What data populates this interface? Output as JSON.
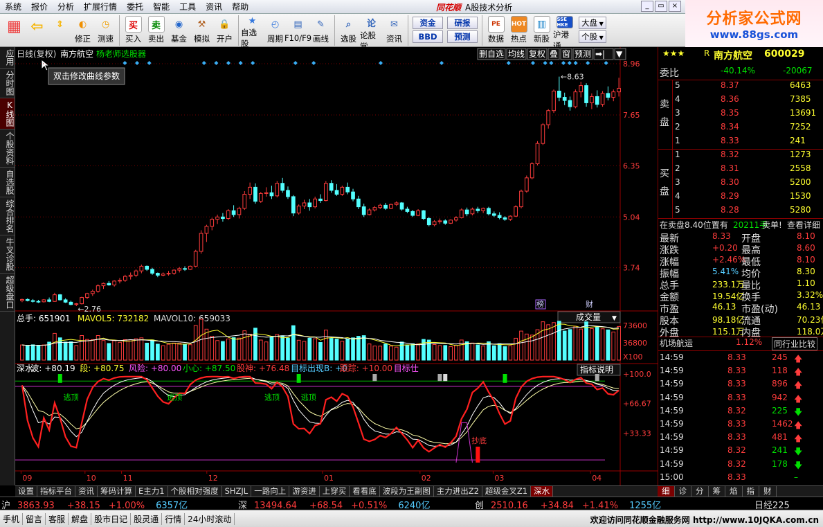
{
  "menu": [
    "系统",
    "报价",
    "分析",
    "扩展行情",
    "委托",
    "智能",
    "工具",
    "资讯",
    "帮助"
  ],
  "app_title": {
    "brand": "同花顺",
    "module": "A股技术分析"
  },
  "window_buttons": [
    "_",
    "▭",
    "×"
  ],
  "toolbar": {
    "buttons": [
      {
        "label": "",
        "icon": "multi-window-icon"
      },
      {
        "label": "",
        "icon": "back-arrow-icon"
      },
      {
        "label": "",
        "icon": "up-down-arrow-icon"
      },
      {
        "label": "修正",
        "icon": "correction-icon"
      },
      {
        "label": "测速",
        "icon": "speed-test-icon"
      },
      {
        "label": "买入",
        "icon": "buy-icon",
        "glyph": "买"
      },
      {
        "label": "卖出",
        "icon": "sell-icon",
        "glyph": "卖"
      },
      {
        "label": "基金",
        "icon": "fund-icon"
      },
      {
        "label": "模拟",
        "icon": "simulate-icon"
      },
      {
        "label": "开户",
        "icon": "lock-icon"
      },
      {
        "label": "自选股",
        "icon": "star-icon"
      },
      {
        "label": "周期",
        "icon": "clock-icon"
      },
      {
        "label": "F10/F9",
        "icon": "f10-icon"
      },
      {
        "label": "画线",
        "icon": "pen-icon"
      },
      {
        "label": "选股",
        "icon": "select-stock-icon"
      },
      {
        "label": "论股堂",
        "icon": "forum-icon"
      },
      {
        "label": "资讯",
        "icon": "news-icon"
      }
    ],
    "pill_buttons": [
      "资金",
      "BBD",
      "研报",
      "预测"
    ],
    "right_buttons": [
      {
        "label": "数据",
        "icon": "pe-icon",
        "glyph": "PE"
      },
      {
        "label": "热点",
        "icon": "hot-icon",
        "glyph": "HOT"
      },
      {
        "label": "新股",
        "icon": "new-stock-icon"
      },
      {
        "label": "沪港通",
        "icon": "hk-connect-icon",
        "glyph": "SSE HKE"
      }
    ],
    "dropdowns": [
      "大盘",
      "个股"
    ]
  },
  "logo": {
    "title": "分析家公式网",
    "url": "www.88gs.com"
  },
  "left_tabs": [
    {
      "label": "应用",
      "active": false
    },
    {
      "label": "分时图",
      "active": false
    },
    {
      "label": "K线图",
      "active": true
    },
    {
      "label": "个股资料",
      "active": false
    },
    {
      "label": "自选股",
      "active": false
    },
    {
      "label": "综合排名",
      "active": false
    },
    {
      "label": "牛叉诊股",
      "active": false
    },
    {
      "label": "超级盘口",
      "active": false
    }
  ],
  "kchart": {
    "period_label": "日线(复权)",
    "stock_name": "南方航空",
    "formula_name": "杨老师选股器",
    "tooltip": "双击修改曲线参数",
    "buttons": [
      "删自选",
      "均线",
      "复权",
      "叠",
      "窗",
      "预测",
      "➡|",
      "▼"
    ],
    "high_label": "8.63",
    "low_label": "2.76",
    "event_labels": [
      "榜",
      "财"
    ],
    "price_ticks": [
      "8.96",
      "7.65",
      "6.35",
      "5.04",
      "3.74"
    ]
  },
  "chart_data": {
    "type": "candlestick",
    "x_ticks": [
      "09",
      "10",
      "11",
      "12",
      "01",
      "02",
      "03",
      "04"
    ],
    "price_axis": {
      "min": 2.76,
      "max": 8.96,
      "ticks": [
        8.96,
        7.65,
        6.35,
        5.04,
        3.74
      ]
    },
    "ohlc": [
      [
        2.9,
        2.95,
        2.86,
        2.93
      ],
      [
        2.93,
        2.96,
        2.88,
        2.9
      ],
      [
        2.9,
        2.94,
        2.85,
        2.88
      ],
      [
        2.88,
        2.92,
        2.84,
        2.87
      ],
      [
        2.87,
        2.94,
        2.85,
        2.92
      ],
      [
        2.92,
        2.98,
        2.86,
        2.88
      ],
      [
        2.88,
        3.1,
        2.87,
        3.05
      ],
      [
        3.05,
        3.07,
        2.9,
        2.92
      ],
      [
        2.92,
        2.96,
        2.84,
        2.86
      ],
      [
        2.86,
        2.9,
        2.78,
        2.8
      ],
      [
        2.8,
        2.84,
        2.76,
        2.82
      ],
      [
        2.82,
        3.0,
        2.8,
        2.98
      ],
      [
        2.98,
        3.1,
        2.94,
        3.08
      ],
      [
        3.08,
        3.18,
        3.02,
        3.14
      ],
      [
        3.14,
        3.32,
        3.1,
        3.28
      ],
      [
        3.28,
        3.36,
        3.2,
        3.34
      ],
      [
        3.34,
        3.4,
        3.28,
        3.3
      ],
      [
        3.3,
        3.42,
        3.26,
        3.4
      ],
      [
        3.4,
        3.48,
        3.34,
        3.42
      ],
      [
        3.42,
        3.56,
        3.38,
        3.52
      ],
      [
        3.52,
        3.62,
        3.44,
        3.55
      ],
      [
        3.55,
        3.7,
        3.5,
        3.66
      ],
      [
        3.66,
        3.82,
        3.6,
        3.78
      ],
      [
        3.78,
        3.8,
        3.66,
        3.7
      ],
      [
        3.7,
        3.74,
        3.56,
        3.6
      ],
      [
        3.6,
        3.62,
        3.5,
        3.55
      ],
      [
        3.55,
        3.62,
        3.52,
        3.58
      ],
      [
        3.58,
        3.66,
        3.54,
        3.6
      ],
      [
        3.6,
        3.7,
        3.56,
        3.68
      ],
      [
        3.68,
        3.76,
        3.62,
        3.72
      ],
      [
        3.72,
        3.78,
        3.66,
        3.7
      ],
      [
        3.7,
        3.8,
        3.68,
        3.78
      ],
      [
        3.78,
        4.2,
        3.76,
        4.16
      ],
      [
        4.16,
        4.7,
        4.1,
        4.62
      ],
      [
        4.62,
        4.84,
        4.4,
        4.8
      ],
      [
        4.8,
        5.02,
        4.7,
        4.98
      ],
      [
        4.98,
        5.1,
        4.86,
        5.04
      ],
      [
        5.04,
        5.14,
        4.92,
        5.0
      ],
      [
        5.0,
        5.24,
        4.96,
        5.2
      ],
      [
        5.2,
        5.34,
        5.04,
        5.1
      ],
      [
        5.1,
        5.3,
        5.0,
        5.26
      ],
      [
        5.26,
        5.7,
        5.22,
        5.62
      ],
      [
        5.62,
        5.92,
        5.5,
        5.8
      ],
      [
        5.8,
        5.9,
        5.38,
        5.44
      ],
      [
        5.44,
        5.68,
        5.4,
        5.64
      ],
      [
        5.64,
        5.8,
        5.56,
        5.66
      ],
      [
        5.66,
        5.84,
        5.5,
        5.58
      ],
      [
        5.58,
        5.96,
        5.54,
        5.9
      ],
      [
        5.9,
        6.04,
        5.66,
        5.72
      ],
      [
        5.72,
        5.82,
        5.5,
        5.56
      ],
      [
        5.56,
        5.6,
        5.06,
        5.14
      ],
      [
        5.14,
        5.36,
        5.1,
        5.32
      ],
      [
        5.32,
        5.48,
        5.24,
        5.4
      ],
      [
        5.4,
        5.5,
        5.2,
        5.3
      ],
      [
        5.3,
        5.56,
        5.26,
        5.5
      ],
      [
        5.5,
        5.62,
        5.4,
        5.46
      ],
      [
        5.46,
        5.96,
        5.44,
        5.9
      ],
      [
        5.9,
        5.98,
        5.66,
        5.72
      ],
      [
        5.72,
        5.88,
        5.58,
        5.62
      ],
      [
        5.62,
        5.84,
        5.58,
        5.8
      ],
      [
        5.8,
        5.92,
        5.62,
        5.68
      ],
      [
        5.68,
        5.76,
        5.44,
        5.5
      ],
      [
        5.5,
        5.58,
        5.24,
        5.3
      ],
      [
        5.3,
        5.38,
        5.04,
        5.1
      ],
      [
        5.1,
        5.26,
        5.08,
        5.22
      ],
      [
        5.22,
        5.32,
        5.18,
        5.28
      ],
      [
        5.28,
        5.38,
        5.24,
        5.34
      ],
      [
        5.34,
        5.4,
        5.22,
        5.26
      ],
      [
        5.26,
        5.38,
        5.24,
        5.36
      ],
      [
        5.36,
        5.44,
        5.32,
        5.4
      ],
      [
        5.4,
        5.42,
        5.2,
        5.24
      ],
      [
        5.24,
        5.3,
        5.14,
        5.18
      ],
      [
        5.18,
        5.22,
        5.04,
        5.08
      ],
      [
        5.08,
        5.24,
        5.06,
        5.2
      ],
      [
        5.2,
        5.22,
        4.96,
        5.0
      ],
      [
        5.0,
        5.04,
        4.8,
        4.84
      ],
      [
        4.84,
        4.96,
        4.8,
        4.92
      ],
      [
        4.92,
        5.0,
        4.86,
        4.94
      ],
      [
        4.94,
        4.98,
        4.84,
        4.88
      ],
      [
        4.88,
        4.98,
        4.86,
        4.96
      ],
      [
        4.96,
        5.06,
        4.92,
        5.02
      ],
      [
        5.02,
        5.26,
        5.0,
        5.22
      ],
      [
        5.22,
        5.28,
        5.06,
        5.12
      ],
      [
        5.12,
        5.28,
        5.08,
        5.24
      ],
      [
        5.24,
        5.3,
        5.14,
        5.2
      ],
      [
        5.2,
        5.28,
        5.14,
        5.26
      ],
      [
        5.26,
        5.3,
        5.08,
        5.12
      ],
      [
        5.12,
        5.18,
        5.04,
        5.08
      ],
      [
        5.08,
        5.16,
        4.98,
        5.02
      ],
      [
        5.02,
        5.06,
        4.94,
        4.98
      ],
      [
        4.98,
        5.08,
        4.94,
        5.06
      ],
      [
        5.06,
        5.34,
        5.04,
        5.3
      ],
      [
        5.3,
        5.74,
        5.26,
        5.7
      ],
      [
        5.7,
        6.1,
        5.66,
        6.04
      ],
      [
        6.04,
        6.44,
        6.0,
        6.4
      ],
      [
        6.4,
        6.98,
        6.36,
        6.92
      ],
      [
        6.92,
        7.44,
        6.88,
        7.4
      ],
      [
        7.4,
        7.8,
        7.3,
        7.76
      ],
      [
        7.76,
        8.3,
        7.7,
        8.26
      ],
      [
        8.26,
        8.63,
        8.0,
        8.1
      ],
      [
        8.1,
        8.22,
        7.9,
        8.02
      ],
      [
        8.02,
        8.12,
        7.76,
        7.86
      ],
      [
        7.86,
        8.3,
        7.82,
        8.24
      ],
      [
        8.24,
        8.5,
        8.1,
        8.4
      ],
      [
        8.4,
        8.46,
        7.86,
        7.96
      ],
      [
        7.96,
        8.2,
        7.8,
        8.12
      ],
      [
        8.12,
        8.28,
        7.84,
        7.92
      ],
      [
        7.92,
        8.26,
        7.86,
        8.2
      ],
      [
        8.2,
        8.38,
        8.02,
        8.1
      ],
      [
        8.1,
        8.3,
        8.0,
        8.24
      ],
      [
        8.24,
        8.6,
        8.12,
        8.33
      ]
    ],
    "volume_axis": {
      "ticks": [
        "73600",
        "36800",
        "X100"
      ]
    },
    "volume_legend": {
      "total": "总手: 651901",
      "ma5": "MAVOL5: 732182",
      "ma10": "MAVOL10: 659033"
    },
    "indicator_axis": {
      "ticks": [
        "+100.0",
        "+66.67",
        "+33.33"
      ]
    },
    "indicator_legend": [
      "深水",
      "波: +80.19",
      "段: +80.75",
      "风险: +80.00",
      "小心: +87.50",
      "股神: +76.48",
      "目标出现B: +0",
      "跟踪: +10.00",
      "目标仕"
    ],
    "indicator_labels": [
      "逃顶",
      "逃顶",
      "逃顶",
      "逃顶",
      "抄底"
    ]
  },
  "vol_panel": {
    "dropdown": "成交量"
  },
  "ind_panel": {
    "button": "指标说明"
  },
  "quote": {
    "stars": "★★★",
    "flag": "R",
    "name": "南方航空",
    "code": "600029",
    "wei_bi": {
      "label": "委比",
      "pct": "-40.14%",
      "diff": "-20067"
    },
    "sell": [
      [
        "5",
        "8.37",
        "6463"
      ],
      [
        "4",
        "8.36",
        "7385"
      ],
      [
        "3",
        "8.35",
        "13691"
      ],
      [
        "2",
        "8.34",
        "7252"
      ],
      [
        "1",
        "8.33",
        "241"
      ]
    ],
    "buy": [
      [
        "1",
        "8.32",
        "1273"
      ],
      [
        "2",
        "8.31",
        "2558"
      ],
      [
        "3",
        "8.30",
        "5200"
      ],
      [
        "4",
        "8.29",
        "1530"
      ],
      [
        "5",
        "8.28",
        "5280"
      ]
    ],
    "sell_label": "卖盘",
    "buy_label": "买盘",
    "alert": {
      "text": "在卖盘8.40位置有",
      "vol": "20211手",
      "action": "卖单!",
      "link": "查看详细"
    },
    "stats": [
      [
        "最新",
        "8.33",
        "开盘",
        "8.10"
      ],
      [
        "涨跌",
        "+0.20",
        "最高",
        "8.60"
      ],
      [
        "涨幅",
        "+2.46%",
        "最低",
        "8.10"
      ],
      [
        "振幅",
        "5.41%",
        "均价",
        "8.30"
      ],
      [
        "总手",
        "233.1万",
        "量比",
        "1.10"
      ],
      [
        "金额",
        "19.54亿",
        "换手",
        "3.32%"
      ],
      [
        "市盈",
        "46.13",
        "市盈(动)",
        "46.13"
      ],
      [
        "股本",
        "98.18亿",
        "流通",
        "70.23亿"
      ],
      [
        "外盘",
        "115.1万",
        "内盘",
        "118.0万"
      ]
    ],
    "sector": {
      "name": "机场航运",
      "pct": "1.12%",
      "button": "同行业比较"
    },
    "ticks": [
      [
        "14:59",
        "8.33",
        "245",
        "up"
      ],
      [
        "14:59",
        "8.33",
        "118",
        "up"
      ],
      [
        "14:59",
        "8.33",
        "896",
        "up"
      ],
      [
        "14:59",
        "8.33",
        "942",
        "up"
      ],
      [
        "14:59",
        "8.32",
        "225",
        "down"
      ],
      [
        "14:59",
        "8.33",
        "1462",
        "up"
      ],
      [
        "14:59",
        "8.33",
        "481",
        "up"
      ],
      [
        "14:59",
        "8.32",
        "241",
        "down"
      ],
      [
        "14:59",
        "8.32",
        "178",
        "down"
      ],
      [
        "15:00",
        "8.33",
        "",
        "none"
      ]
    ]
  },
  "bottom_tabs": [
    "设置",
    "指标平台",
    "资讯",
    "筹码计算",
    "E主力1",
    "个股相对强度",
    "SHZJL",
    "一路向上",
    "游资进",
    "上穿买",
    "看看底",
    "波段为王副图",
    "主力进出Z2",
    "超级金叉Z1",
    "深水"
  ],
  "right_tabs": [
    "细",
    "诊",
    "分",
    "筹",
    "焰",
    "指",
    "财"
  ],
  "ticker": [
    {
      "mkt": "沪",
      "idx": "3863.93",
      "chg": "+38.15",
      "pct": "+1.00%",
      "amt": "6357亿"
    },
    {
      "mkt": "深",
      "idx": "13494.64",
      "chg": "+68.54",
      "pct": "+0.51%",
      "amt": "6240亿"
    },
    {
      "mkt": "创",
      "idx": "2510.16",
      "chg": "+34.84",
      "pct": "+1.41%",
      "amt": "1255亿"
    }
  ],
  "ticker_extra": "日经225",
  "status_items": [
    "手机",
    "留言",
    "客服",
    "解盘",
    "股市日记",
    "股灵通",
    "行情",
    "24小时滚动"
  ],
  "status_welcome": "欢迎访问同花顺金融服务网 http://www.10JQKA.com.cn",
  "colors": {
    "up": "#ff3c3c",
    "down": "#54ffff",
    "green": "#00e000",
    "bg": "#000000"
  }
}
